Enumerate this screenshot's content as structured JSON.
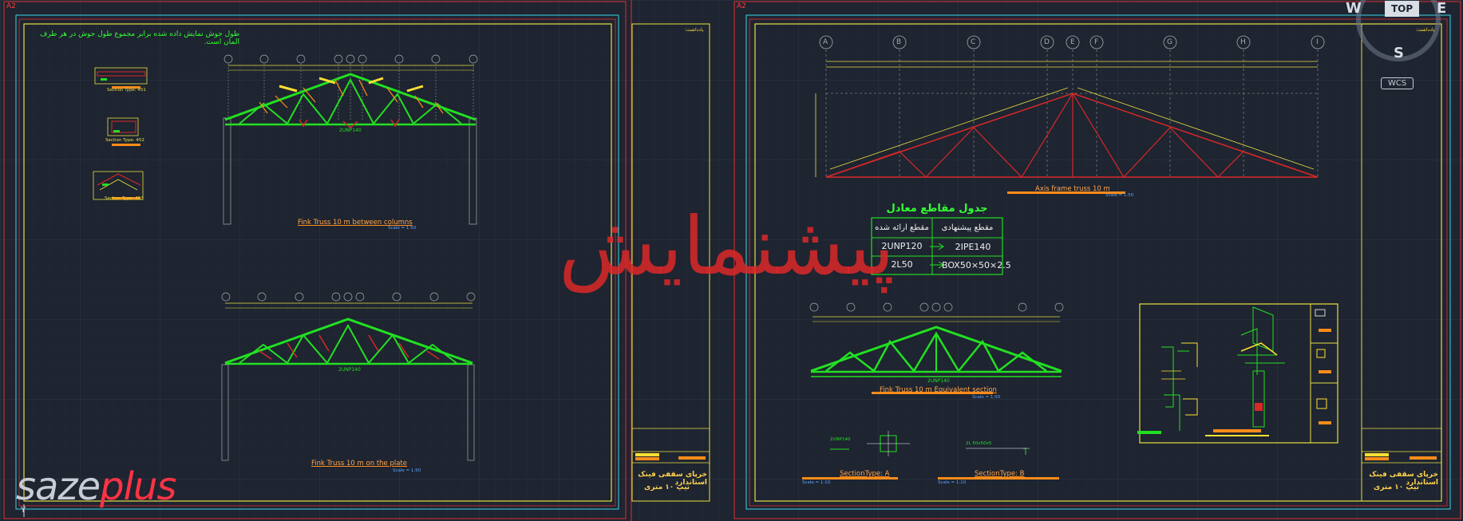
{
  "sheets": {
    "left_tag": "A2",
    "right_tag": "A2"
  },
  "left": {
    "note": "طول جوش نمایش داده شده برابر مجموع طول جوش در هر طرف المان است.",
    "sections": [
      "Section Type: 451",
      "Section Type: 452",
      "Section Type: 453"
    ],
    "truss_top": {
      "caption": "Fink Truss 10 m between columns",
      "scale": "Scale = 1:50",
      "member": "2UNP140"
    },
    "truss_bottom": {
      "caption": "Fink Truss 10 m on the plate",
      "scale": "Scale = 1:50",
      "member": "2UNP140"
    },
    "title_block": {
      "label": "یادداشت:",
      "project": "خرپای سقفی فینک استاندارد",
      "subtitle": "تیپ ۱۰ متری"
    }
  },
  "right": {
    "axes": [
      "A",
      "B",
      "C",
      "D",
      "E",
      "F",
      "G",
      "H",
      "I"
    ],
    "axis_caption": "Axis frame truss 10 m",
    "axis_scale": "Scale = 1:50",
    "table": {
      "title": "جدول مقاطع معادل",
      "col_given": "مقطع ارائه شده",
      "col_suggested": "مقطع پیشنهادی",
      "rows": [
        {
          "given": "2UNP120",
          "suggested": "2IPE140"
        },
        {
          "given": "2L50",
          "suggested": "BOX50×50×2.5"
        }
      ]
    },
    "equiv": {
      "caption": "Fink Truss 10 m Equivalent section",
      "scale": "Scale = 1:50",
      "member": "2UNP140"
    },
    "section_a": {
      "caption": "SectionType: A",
      "label": "2UNP140",
      "scale": "Scale = 1:10"
    },
    "section_b": {
      "caption": "SectionType: B",
      "label": "2L 50x50x5",
      "scale": "Scale = 1:10"
    },
    "title_block": {
      "label": "یادداشت:",
      "project": "خرپای سقفی فینک استاندارد",
      "subtitle": "تیپ ۱۰ متری"
    }
  },
  "nav_cube": {
    "west": "W",
    "top": "TOP",
    "east": "E",
    "south": "S",
    "wcs": "WCS"
  },
  "watermark": "پیشنمایش",
  "logo": {
    "part1": "saze",
    "part2": "plus"
  },
  "ucs": "Y",
  "colors": {
    "bg": "#1e2430",
    "frame_red": "#e03030",
    "frame_cyan": "#3ad6e6",
    "border_yellow": "#e8e040",
    "truss_green": "#22e022",
    "truss_red": "#d82828",
    "accent_orange": "#ff8c1a"
  }
}
